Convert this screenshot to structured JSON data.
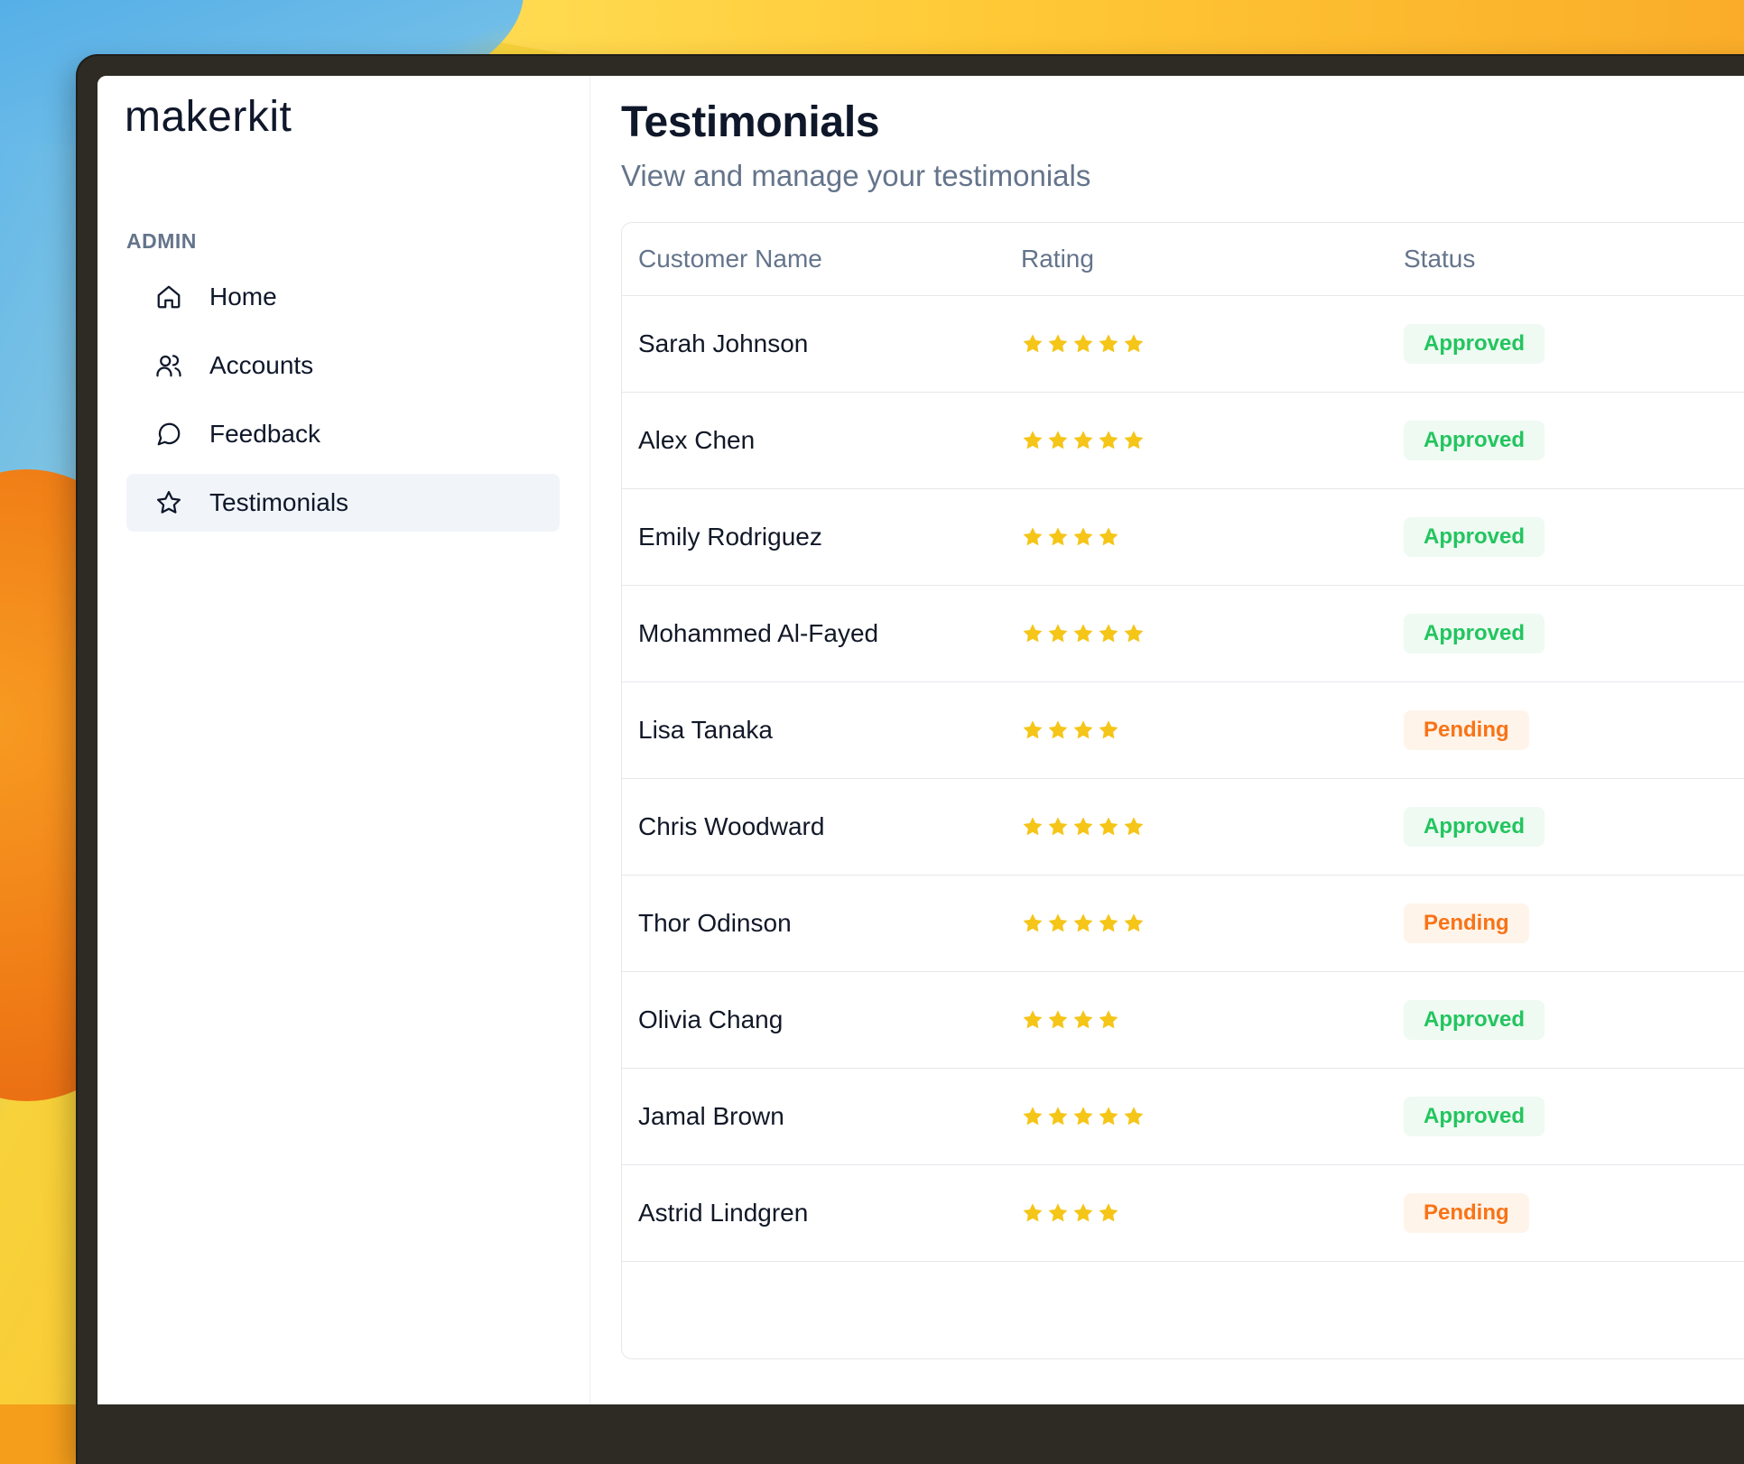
{
  "app": {
    "logo_text": "makerkit"
  },
  "sidebar": {
    "section_label": "ADMIN",
    "items": [
      {
        "label": "Home",
        "icon": "home-icon",
        "active": false
      },
      {
        "label": "Accounts",
        "icon": "users-icon",
        "active": false
      },
      {
        "label": "Feedback",
        "icon": "message-circle-icon",
        "active": false
      },
      {
        "label": "Testimonials",
        "icon": "star-icon",
        "active": true
      }
    ]
  },
  "page": {
    "title": "Testimonials",
    "subtitle": "View and manage your testimonials"
  },
  "table": {
    "columns": [
      "Customer Name",
      "Rating",
      "Status"
    ],
    "rows": [
      {
        "name": "Sarah Johnson",
        "rating": 5,
        "status": "Approved"
      },
      {
        "name": "Alex Chen",
        "rating": 5,
        "status": "Approved"
      },
      {
        "name": "Emily Rodriguez",
        "rating": 4,
        "status": "Approved"
      },
      {
        "name": "Mohammed Al-Fayed",
        "rating": 5,
        "status": "Approved"
      },
      {
        "name": "Lisa Tanaka",
        "rating": 4,
        "status": "Pending"
      },
      {
        "name": "Chris Woodward",
        "rating": 5,
        "status": "Approved"
      },
      {
        "name": "Thor Odinson",
        "rating": 5,
        "status": "Pending"
      },
      {
        "name": "Olivia Chang",
        "rating": 4,
        "status": "Approved"
      },
      {
        "name": "Jamal Brown",
        "rating": 5,
        "status": "Approved"
      },
      {
        "name": "Astrid Lindgren",
        "rating": 4,
        "status": "Pending"
      }
    ]
  },
  "colors": {
    "star": "#f5c518",
    "approved_text": "#22c55e",
    "approved_bg": "#eefaf2",
    "pending_text": "#f97316",
    "pending_bg": "#fff4ea"
  }
}
